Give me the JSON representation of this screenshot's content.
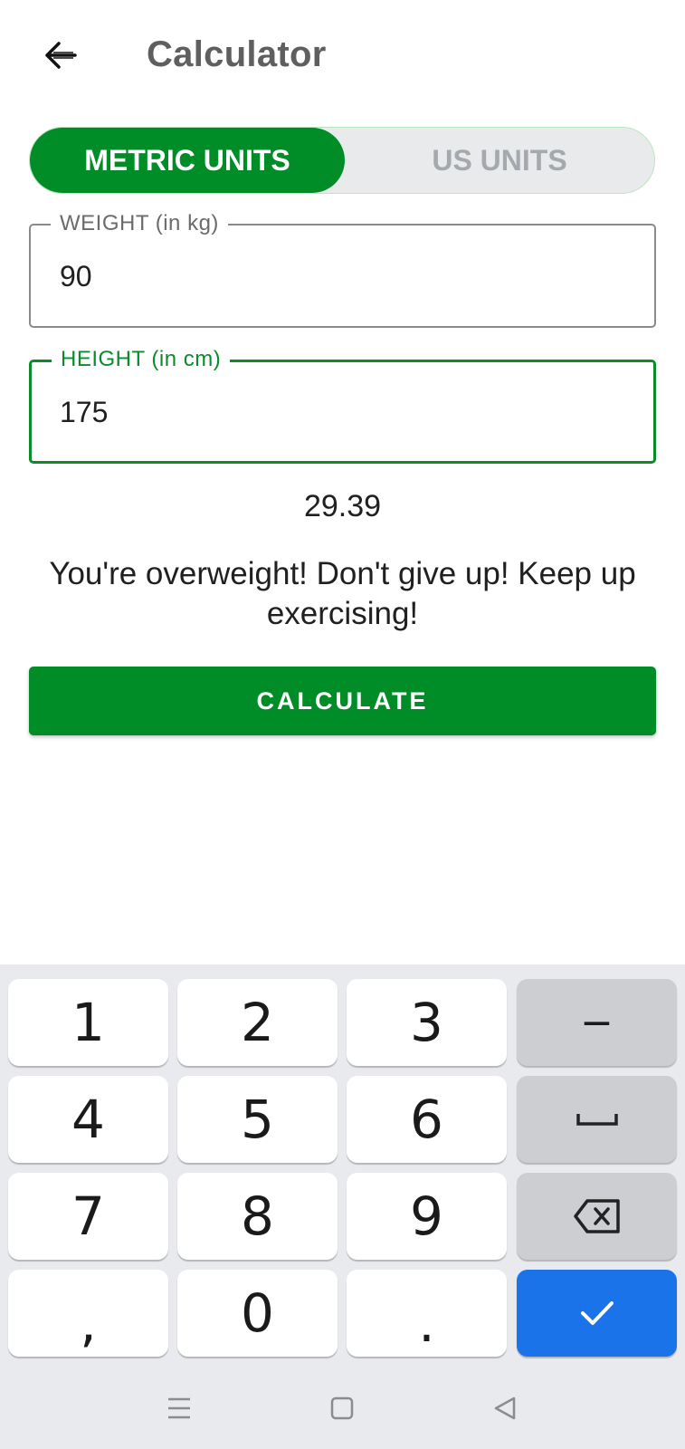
{
  "appbar": {
    "title": "Calculator",
    "back_icon": "arrow-back-icon"
  },
  "units_toggle": {
    "metric_label": "METRIC UNITS",
    "us_label": "US UNITS",
    "selected": "METRIC UNITS"
  },
  "weight_field": {
    "label": "WEIGHT (in kg)",
    "value": "90"
  },
  "height_field": {
    "label": "HEIGHT (in cm)",
    "value": "175"
  },
  "result": {
    "bmi": "29.39",
    "message": "You're overweight! Don't give up! Keep up exercising!"
  },
  "calculate_label": "CALCULATE",
  "keyboard": {
    "digit_keys": [
      "1",
      "2",
      "3",
      "4",
      "5",
      "6",
      "7",
      "8",
      "9",
      "0"
    ],
    "comma": ",",
    "period": ".",
    "minus": "−",
    "space_icon": "space-bar-icon",
    "backspace_icon": "backspace-icon",
    "done_icon": "check-icon"
  },
  "navbar": {
    "icons": [
      "menu-icon",
      "home-square-icon",
      "back-triangle-icon"
    ]
  },
  "colors": {
    "accent_green": "#008c27",
    "keyboard_blue": "#1a73e8",
    "inactive_gray": "#a5a9ae"
  }
}
